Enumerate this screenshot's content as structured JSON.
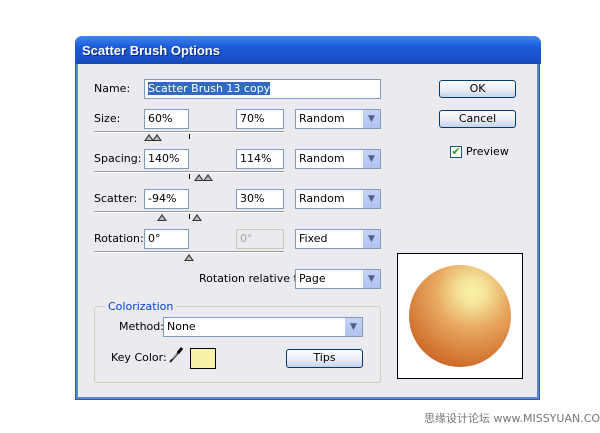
{
  "dialog": {
    "title": "Scatter Brush Options"
  },
  "name": {
    "label": "Name:",
    "value": "Scatter Brush 13 copy"
  },
  "rows": [
    {
      "label": "Size:",
      "min": "60%",
      "max": "70%",
      "mode": "Random",
      "slider_markers_pct": [
        29,
        33
      ],
      "max_disabled": false
    },
    {
      "label": "Spacing:",
      "min": "140%",
      "max": "114%",
      "mode": "Random",
      "slider_markers_pct": [
        55,
        60
      ],
      "max_disabled": false
    },
    {
      "label": "Scatter:",
      "min": "-94%",
      "max": "30%",
      "mode": "Random",
      "slider_markers_pct": [
        36,
        54
      ],
      "max_disabled": false
    },
    {
      "label": "Rotation:",
      "min": "0°",
      "max": "0°",
      "mode": "Fixed",
      "slider_markers_pct": [
        50
      ],
      "max_disabled": true
    }
  ],
  "rotation_relative": {
    "label": "Rotation relative to:",
    "value": "Page"
  },
  "colorization": {
    "legend": "Colorization",
    "method_label": "Method:",
    "method_value": "None",
    "key_color_label": "Key Color:",
    "key_color": "#f8f2a8",
    "tips_label": "Tips"
  },
  "buttons": {
    "ok": "OK",
    "cancel": "Cancel"
  },
  "preview": {
    "label": "Preview",
    "checked": true
  },
  "watermark": "思缘设计论坛  www.MISSYUAN.COM"
}
